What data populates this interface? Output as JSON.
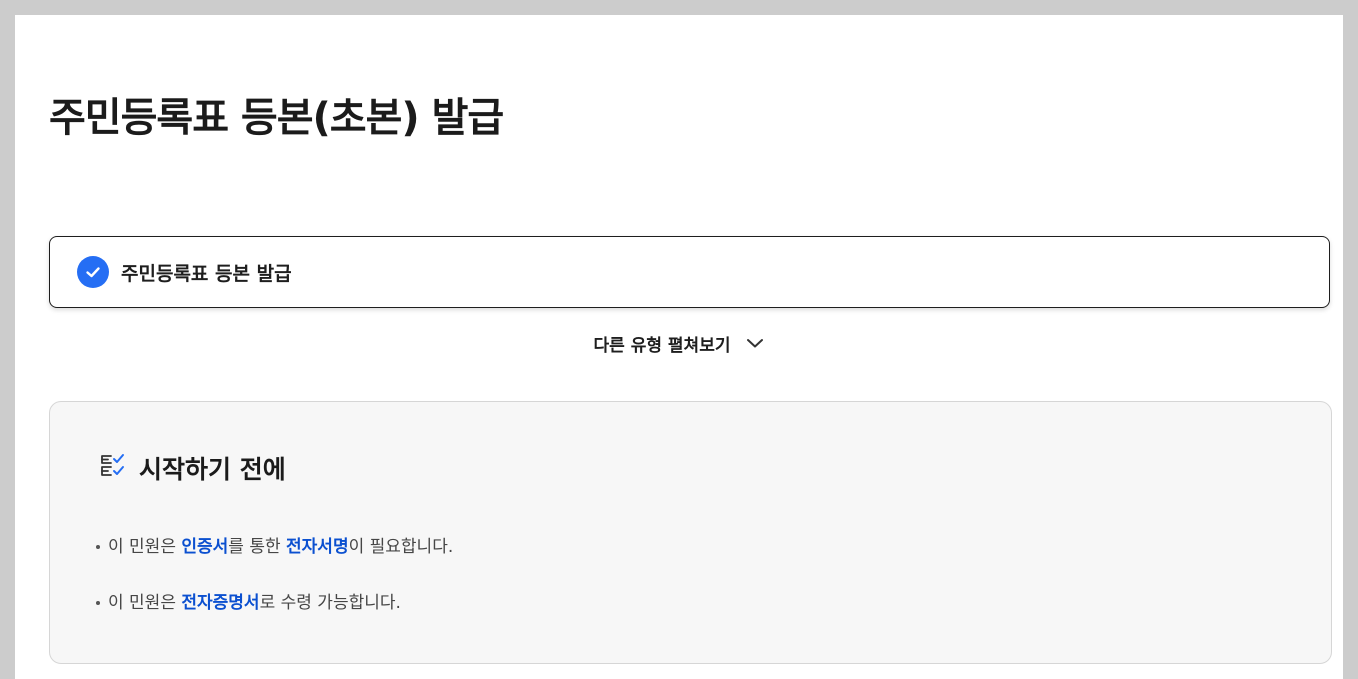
{
  "page": {
    "title": "주민등록표 등본(초본) 발급"
  },
  "selected_option": {
    "label": "주민등록표 등본 발급",
    "icon": "check-circle-icon",
    "checked": true
  },
  "expand_toggle": {
    "label": "다른 유형 펼쳐보기",
    "icon": "chevron-down-icon"
  },
  "info_panel": {
    "title": "시작하기 전에",
    "icon": "checklist-icon",
    "notices": [
      {
        "prefix": "이 민원은 ",
        "highlight1": "인증서",
        "middle": "를 통한 ",
        "highlight2": "전자서명",
        "suffix": "이 필요합니다."
      },
      {
        "prefix": "이 민원은 ",
        "highlight1": "전자증명서",
        "suffix": "로 수령 가능합니다."
      }
    ]
  },
  "colors": {
    "accent": "#256ef4",
    "highlight_text": "#0b50d0",
    "panel_background": "#f7f7f7"
  }
}
